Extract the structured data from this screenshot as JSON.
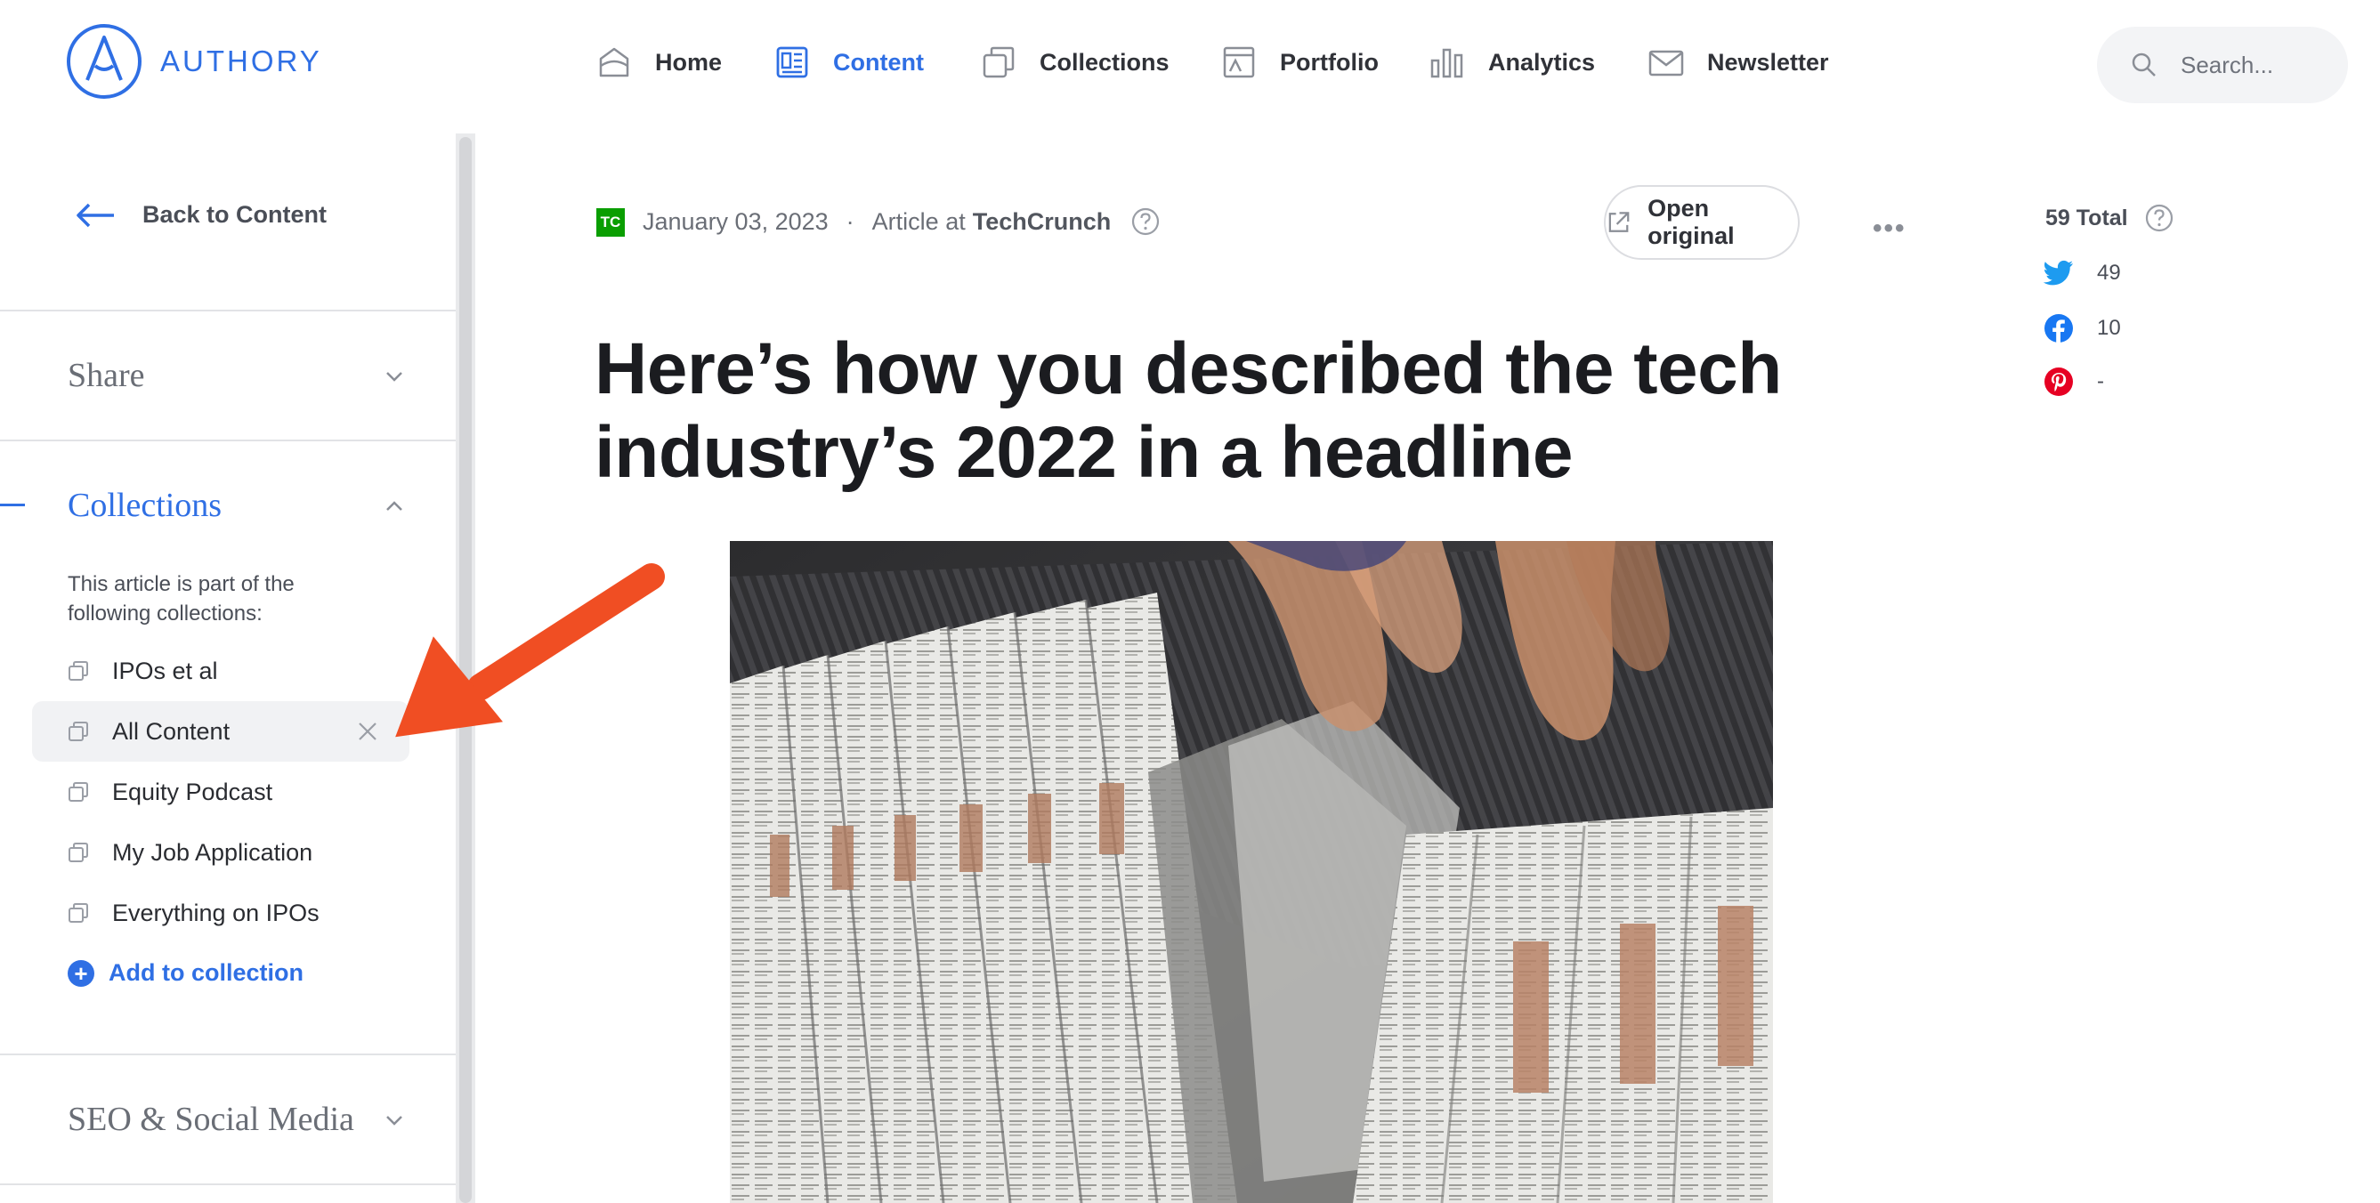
{
  "brand": {
    "name": "AUTHORY"
  },
  "nav": {
    "items": [
      {
        "label": "Home",
        "icon": "home-icon",
        "active": false
      },
      {
        "label": "Content",
        "icon": "content-icon",
        "active": true
      },
      {
        "label": "Collections",
        "icon": "collections-icon",
        "active": false
      },
      {
        "label": "Portfolio",
        "icon": "portfolio-icon",
        "active": false
      },
      {
        "label": "Analytics",
        "icon": "analytics-icon",
        "active": false
      },
      {
        "label": "Newsletter",
        "icon": "newsletter-icon",
        "active": false
      }
    ],
    "search_placeholder": "Search..."
  },
  "sidebar": {
    "back_label": "Back to Content",
    "sections": {
      "share": {
        "title": "Share",
        "expanded": false
      },
      "collections": {
        "title": "Collections",
        "expanded": true,
        "description": "This article is part of the following collections:",
        "items": [
          {
            "label": "IPOs et al",
            "highlighted": false
          },
          {
            "label": "All Content",
            "highlighted": true
          },
          {
            "label": "Equity Podcast",
            "highlighted": false
          },
          {
            "label": "My Job Application",
            "highlighted": false
          },
          {
            "label": "Everything on IPOs",
            "highlighted": false
          }
        ],
        "add_label": "Add to collection"
      },
      "seo": {
        "title": "SEO & Social Media",
        "expanded": false
      }
    }
  },
  "article": {
    "publisher_logo_text": "TC",
    "date": "January 03, 2023",
    "type_prefix": "Article at",
    "publisher": "TechCrunch",
    "open_original_label": "Open original",
    "more_label": "•••",
    "headline": "Here’s how you described the tech industry’s 2022 in a headline"
  },
  "stats": {
    "total_label": "59 Total",
    "rows": [
      {
        "network": "twitter",
        "value": "49",
        "color": "#1d9bf0"
      },
      {
        "network": "facebook",
        "value": "10",
        "color": "#1877f2"
      },
      {
        "network": "pinterest",
        "value": "-",
        "color": "#e60023"
      }
    ]
  },
  "colors": {
    "accent": "#2f6fe4",
    "annotation_arrow": "#f04e23"
  }
}
